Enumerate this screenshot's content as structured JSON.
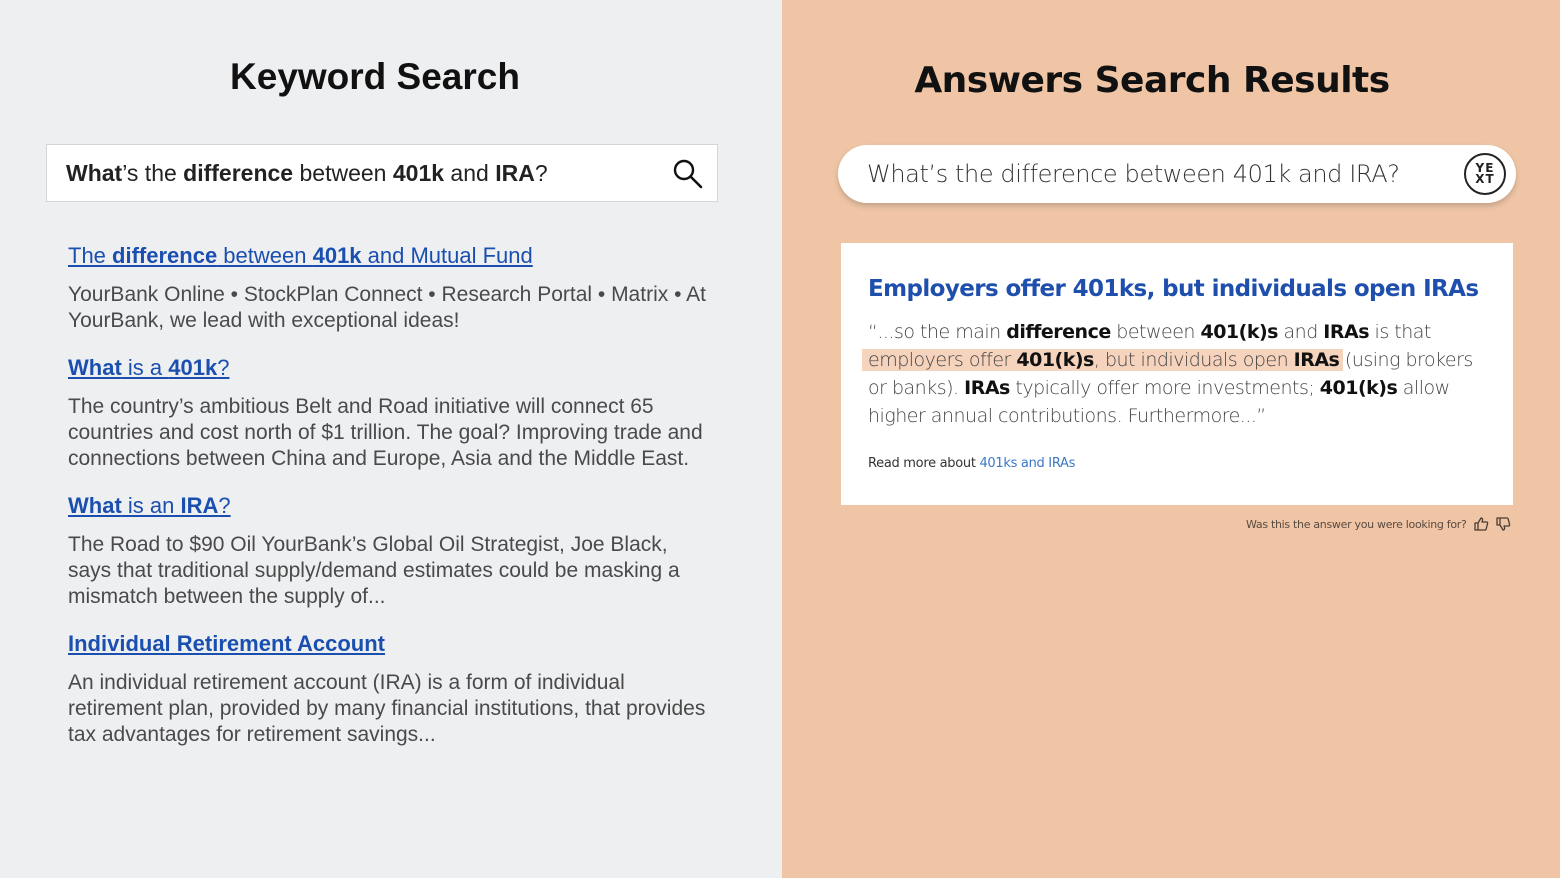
{
  "left_panel": {
    "title": "Keyword Search",
    "query": {
      "part1": "What",
      "part2": "’s the ",
      "part3": "difference",
      "part4": " between ",
      "part5": "401k",
      "part6": " and ",
      "part7": "IRA",
      "part8": "?"
    },
    "search_icon": "search-icon",
    "results": [
      {
        "title_parts": [
          "The ",
          "difference",
          " between ",
          "401k",
          " and Mutual Fund"
        ],
        "description": "YourBank Online • StockPlan Connect • Research Portal • Matrix • At YourBank, we lead with exceptional ideas!"
      },
      {
        "title_parts": [
          "What",
          " is a ",
          "401k",
          "?"
        ],
        "description": "The country’s ambitious Belt and Road initiative will connect 65 countries and cost north of $1 trillion. The goal? Improving trade and connections between China and Europe, Asia and the Middle East."
      },
      {
        "title_parts": [
          "What",
          " is an ",
          "IRA",
          "?"
        ],
        "description": "The Road to $90 Oil YourBank’s Global Oil Strategist, Joe Black, says that traditional supply/demand estimates could be masking a mismatch between the supply of..."
      },
      {
        "title": "Individual Retirement Account",
        "description": "An individual retirement account (IRA) is a form of individual retirement plan, provided by many financial institutions, that provides tax advantages for retirement savings..."
      }
    ]
  },
  "right_panel": {
    "title": "Answers Search Results",
    "query": "What’s the difference between 401k and IRA?",
    "logo_top": "YE",
    "logo_bottom": "XT",
    "answer": {
      "title": "Employers offer 401ks, but individuals open IRAs",
      "snippet": {
        "s1": "“...so the main ",
        "s2": "difference",
        "s3": " between ",
        "s4": "401(k)s",
        "s5": " and ",
        "s6": "IRAs",
        "s7": " is that ",
        "h1": "employers offer ",
        "h2": "401(k)s",
        "h3": ", but individuals open ",
        "h4": "IRAs",
        "s8": " (using brokers or banks). ",
        "s9": "IRAs",
        "s10": " typically offer more investments; ",
        "s11": "401(k)s",
        "s12": " allow higher annual contributions. Furthermore...”"
      },
      "read_more_prefix": "Read more about ",
      "read_more_link": "401ks and IRAs"
    },
    "feedback_text": "Was this the answer you were looking for?",
    "colors": {
      "background": "#efc5a6",
      "title_blue": "#1f4fad",
      "highlight": "#f6d3bd"
    }
  }
}
